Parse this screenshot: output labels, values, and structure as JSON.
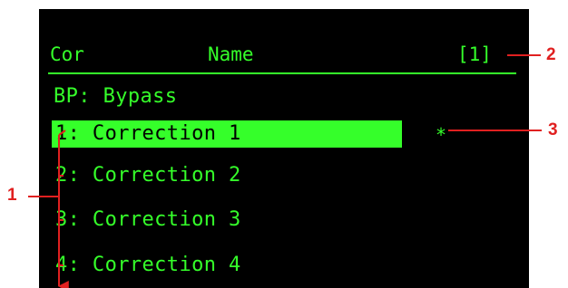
{
  "header": {
    "cor_label": "Cor",
    "name_label": "Name",
    "index": "[1]"
  },
  "list": {
    "bypass": "BP: Bypass",
    "items": [
      {
        "label": "1: Correction 1",
        "selected": true
      },
      {
        "label": "2: Correction 2",
        "selected": false
      },
      {
        "label": "3: Correction 3",
        "selected": false
      },
      {
        "label": "4: Correction 4",
        "selected": false
      }
    ],
    "active_marker": "*"
  },
  "callouts": {
    "one": "1",
    "two": "2",
    "three": "3"
  },
  "colors": {
    "screen_background": "#000000",
    "text": "#35ff2a",
    "selection_background": "#35ff2a",
    "selection_text": "#000000",
    "callout": "#e02020"
  }
}
